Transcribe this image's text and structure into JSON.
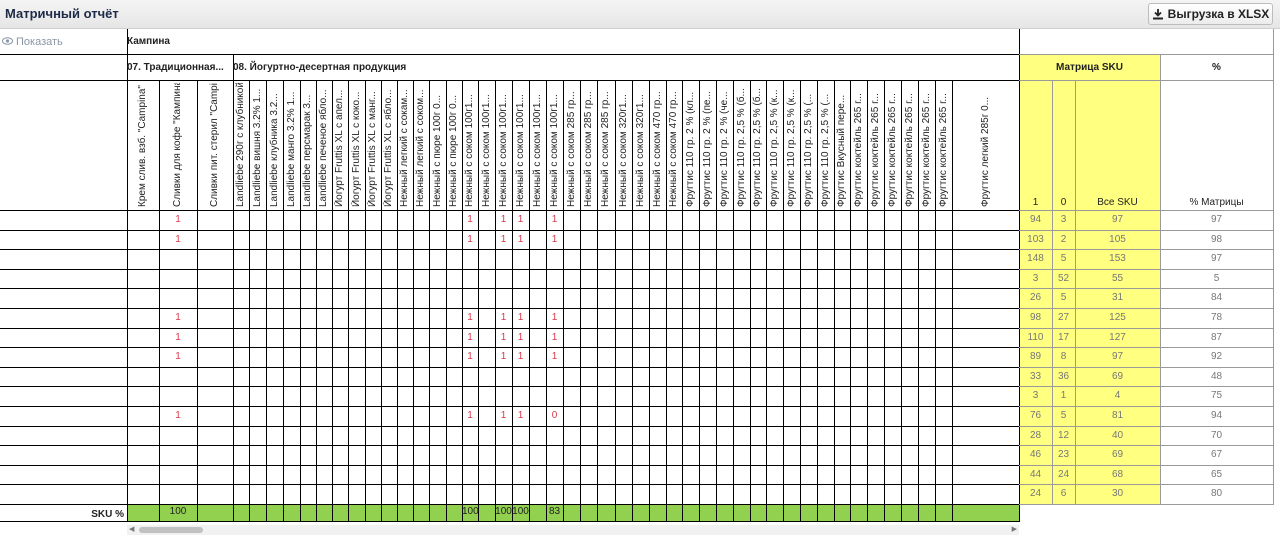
{
  "app": {
    "title": "Матричный отчёт",
    "export_label": "Выгрузка в XLSX",
    "show_label": "Показать"
  },
  "header": {
    "campaign_label": "Кампина",
    "group1": "07. Традиционная...",
    "group2": "08. Йогуртно-десертная продукция",
    "matrix_sku": "Матрица SKU",
    "percent": "%",
    "col_1": "1",
    "col_0": "0",
    "col_all": "Все SKU",
    "col_pct": "% Матрицы"
  },
  "sku_columns": [
    "Крем слив. взб. \"Campina\"",
    "Сливки для кофе \"Кампина\"",
    "Сливки пит. стерил \"Campina\"",
    "Landliebe 290г с клубникой",
    "Landliebe вишня 3.2% 1...",
    "Landliebe клубника 3.2...",
    "Landliebe манго 3.2% 1...",
    "Landliebe персмарак 3...",
    "Landliebe печеное ябло...",
    "Йогурт Fruttis XL с апел...",
    "Йогурт Fruttis XL с коко...",
    "Йогурт Fruttis XL с манг...",
    "Йогурт Fruttis XL с ябло...",
    "Нежный легкий с сокам...",
    "Нежный легкий с соком...",
    "Нежный с пюре 100г 0...",
    "Нежный с пюре 100г 0...",
    "Нежный с соком 100г1...",
    "Нежный с соком 100г1...",
    "Нежный с соком 100г1...",
    "Нежный с соком 100г1...",
    "Нежный с соком 100г1...",
    "Нежный с соком 100г1...",
    "Нежный с соком 285 гр...",
    "Нежный с соком 285 гр...",
    "Нежный с соком 285 гр...",
    "Нежный с соком 320г1...",
    "Нежный с соком 320г1...",
    "Нежный с соком 470 гр...",
    "Нежный с соком 470 гр...",
    "Фругтис 110 гр. 2 % (кл...",
    "Фругтис 110 гр. 2 % (пе...",
    "Фругтис 110 гр. 2 % (че...",
    "Фругтис 110 гр. 2,5 % (б...",
    "Фругтис 110 гр. 2,5 % (б...",
    "Фругтис 110 гр. 2,5 % (к...",
    "Фругтис 110 гр. 2,5 % (к...",
    "Фругтис 110 гр. 2,5 % (...",
    "Фругтис 110 гр. 2,5 % (...",
    "Фругтис Вкусный пере...",
    "Фругтис коктейль 265 г...",
    "Фругтис коктейль 265 г...",
    "Фругтис коктейль 265 г...",
    "Фругтис коктейль 265 г...",
    "Фругтис коктейль 265 г...",
    "Фругтис коктейль 265 г...",
    "Фругтис легкий 285г 0..."
  ],
  "rows": [
    {
      "marks": {
        "1": "1",
        "17": "1",
        "19": "1",
        "20": "1",
        "22": "1"
      },
      "c1": "94",
      "c0": "3",
      "all": "97",
      "pct": "97"
    },
    {
      "marks": {
        "1": "1",
        "17": "1",
        "19": "1",
        "20": "1",
        "22": "1"
      },
      "c1": "103",
      "c0": "2",
      "all": "105",
      "pct": "98"
    },
    {
      "marks": {},
      "c1": "148",
      "c0": "5",
      "all": "153",
      "pct": "97"
    },
    {
      "marks": {},
      "c1": "3",
      "c0": "52",
      "all": "55",
      "pct": "5"
    },
    {
      "marks": {},
      "c1": "26",
      "c0": "5",
      "all": "31",
      "pct": "84"
    },
    {
      "marks": {
        "1": "1",
        "17": "1",
        "19": "1",
        "20": "1",
        "22": "1"
      },
      "c1": "98",
      "c0": "27",
      "all": "125",
      "pct": "78"
    },
    {
      "marks": {
        "1": "1",
        "17": "1",
        "19": "1",
        "20": "1",
        "22": "1"
      },
      "c1": "110",
      "c0": "17",
      "all": "127",
      "pct": "87"
    },
    {
      "marks": {
        "1": "1",
        "17": "1",
        "19": "1",
        "20": "1",
        "22": "1"
      },
      "c1": "89",
      "c0": "8",
      "all": "97",
      "pct": "92"
    },
    {
      "marks": {},
      "c1": "33",
      "c0": "36",
      "all": "69",
      "pct": "48"
    },
    {
      "marks": {},
      "c1": "3",
      "c0": "1",
      "all": "4",
      "pct": "75"
    },
    {
      "marks": {
        "1": "1",
        "17": "1",
        "19": "1",
        "20": "1",
        "22": "0"
      },
      "c1": "76",
      "c0": "5",
      "all": "81",
      "pct": "94"
    },
    {
      "marks": {},
      "c1": "28",
      "c0": "12",
      "all": "40",
      "pct": "70"
    },
    {
      "marks": {},
      "c1": "46",
      "c0": "23",
      "all": "69",
      "pct": "67"
    },
    {
      "marks": {},
      "c1": "44",
      "c0": "24",
      "all": "68",
      "pct": "65"
    },
    {
      "marks": {},
      "c1": "24",
      "c0": "6",
      "all": "30",
      "pct": "80"
    }
  ],
  "footer": {
    "label": "SKU %",
    "values": {
      "1": "100",
      "17": "100",
      "19": "100",
      "20": "100",
      "22": "83"
    }
  },
  "colors": {
    "highlight_yellow": "#ffff80",
    "footer_green": "#92d050",
    "mark_red": "#d8394b"
  }
}
